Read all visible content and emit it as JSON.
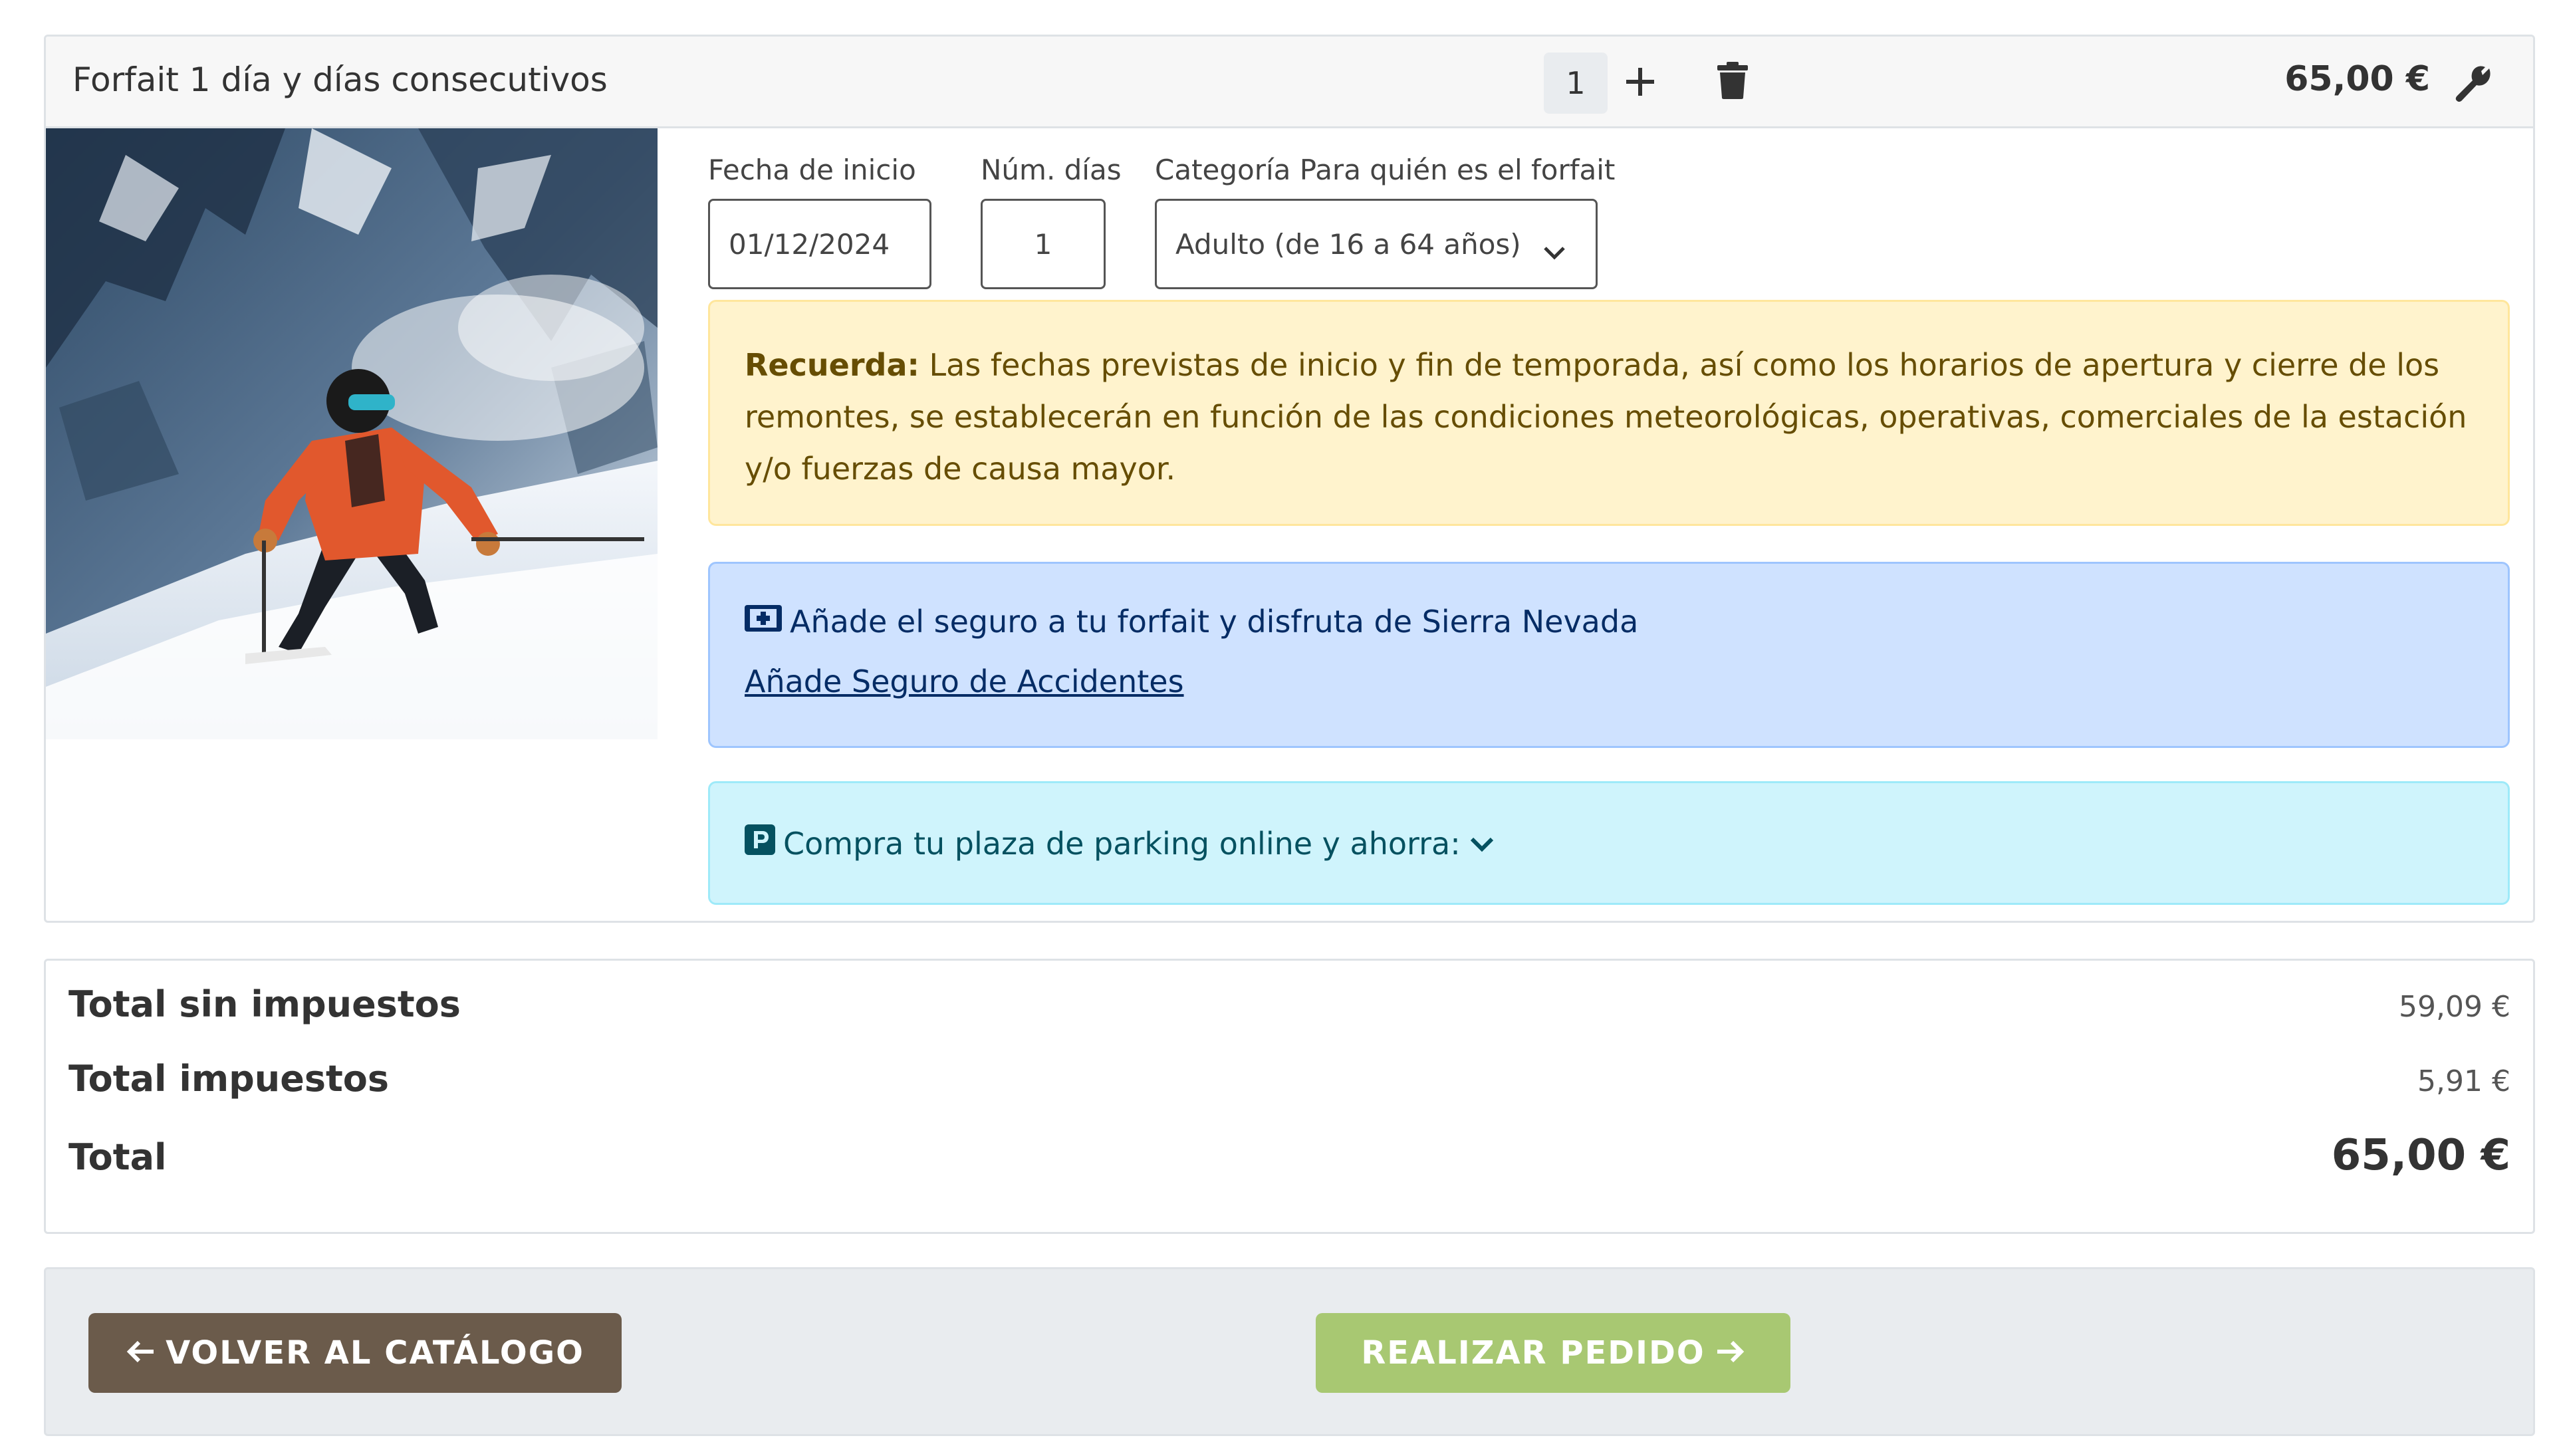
{
  "product": {
    "title": "Forfait 1 día y días consecutivos",
    "quantity": "1",
    "price": "65,00 €",
    "icons": {
      "add": "plus-icon",
      "delete": "trash-icon",
      "edit": "wrench-icon"
    }
  },
  "form": {
    "start_date_label": "Fecha de inicio",
    "start_date_value": "01/12/2024",
    "days_label": "Núm. días",
    "days_value": "1",
    "category_label": "Categoría Para quién es el forfait",
    "category_value": "Adulto (de 16 a 64 años)"
  },
  "alerts": {
    "reminder_bold": "Recuerda:",
    "reminder_text": " Las fechas previstas de inicio y fin de temporada, así como los horarios de apertura y cierre de los remontes, se establecerán en función de las condiciones meteorológicas, operativas, comerciales de la estación y/o fuerzas de causa mayor.",
    "insurance_text": "Añade el seguro a tu forfait y disfruta de Sierra Nevada",
    "insurance_link": "Añade Seguro de Accidentes",
    "parking_text": "Compra tu plaza de parking online y ahorra:"
  },
  "totals": {
    "subtotal_label": "Total sin impuestos",
    "subtotal_value": "59,09 €",
    "tax_label": "Total impuestos",
    "tax_value": "5,91 €",
    "total_label": "Total",
    "total_value": "65,00 €"
  },
  "actions": {
    "back_label": "VOLVER AL CATÁLOGO",
    "order_label": "REALIZAR PEDIDO"
  },
  "colors": {
    "back_button": "#6b5b4b",
    "order_button": "#a8c872",
    "warning_bg": "#fff3cd",
    "info_bg": "#cfe2ff",
    "cyan_bg": "#cff4fc"
  }
}
